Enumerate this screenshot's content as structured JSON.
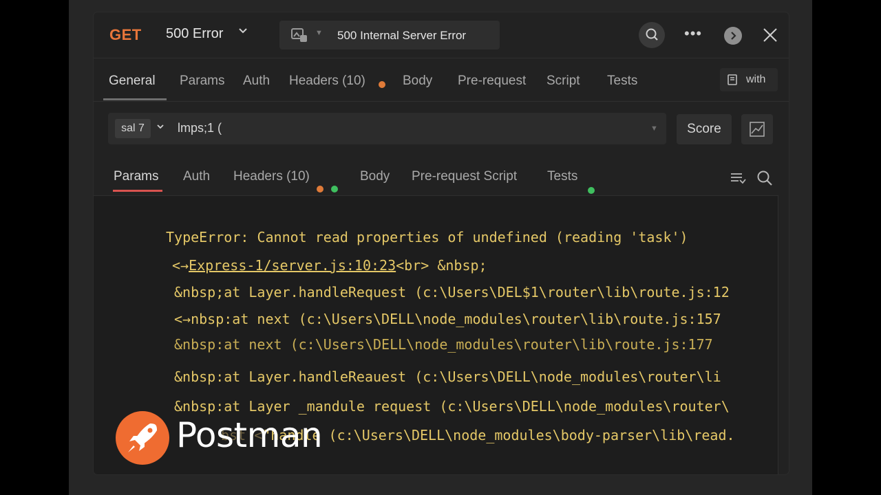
{
  "titlebar": {
    "method": "GET",
    "request_name": "500 Error",
    "status_text": "500 Internal Server Error",
    "more_label": "•••"
  },
  "tabs_top": [
    {
      "label": "General",
      "active": true
    },
    {
      "label": "Params"
    },
    {
      "label": "Auth"
    },
    {
      "label": "Headers (10)"
    },
    {
      "label": "Body"
    },
    {
      "label": "Pre-request"
    },
    {
      "label": "Script"
    },
    {
      "label": "Tests"
    }
  ],
  "with_label": "with",
  "url": {
    "env_label": "sal 7",
    "value": "lmps;1 ("
  },
  "score_label": "Score",
  "tabs_response": [
    {
      "label": "Params",
      "active": true
    },
    {
      "label": "Auth"
    },
    {
      "label": "Headers (10)"
    },
    {
      "label": "Body"
    },
    {
      "label": "Pre-request Script"
    },
    {
      "label": "Tests"
    }
  ],
  "console": {
    "error_line": "TypeError: Cannot read properties of undefined (reading 'task')",
    "line2_prefix": "<→",
    "line2_link": "Express-1/server.js:10:23",
    "line2_suffix": "<br> &nbsp;",
    "line3": "&nbsp;at Layer.handleRequest (c:\\Users\\DEL$1\\router\\lib\\route.js:12",
    "line4": "<→nbsp:at next (c:\\Users\\DELL\\node_modules\\router\\lib\\route.js:157",
    "line5": "&nbsp:at next (c:\\Users\\DELL\\node_modules\\router\\lib\\route.js:177",
    "line6": "&nbsp:at Layer.handleReauest (c:\\Users\\DELL\\node_modules\\router\\li",
    "line7": "&nbsp:at Layer _mandule request (c:\\Users\\DELL\\node_modules\\router\\",
    "line8_faded": "bst <",
    "line8": "\"handle (c:\\Users\\DELL\\node_modules\\body-parser\\lib\\read."
  },
  "brand": {
    "name": "Postman"
  },
  "colors": {
    "accent": "#e8763a",
    "console_text": "#e5c867",
    "dot_orange": "#e07b39",
    "dot_green": "#3fbf5f",
    "active_underline": "#d9534f"
  }
}
